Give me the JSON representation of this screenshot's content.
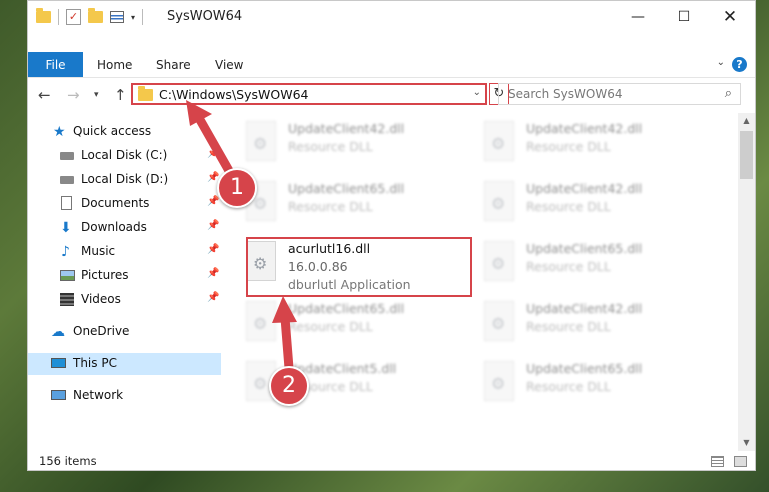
{
  "window": {
    "title": "SysWOW64"
  },
  "ribbon": {
    "tabs": [
      "File",
      "Home",
      "Share",
      "View"
    ]
  },
  "address": {
    "path": "C:\\Windows\\SysWOW64"
  },
  "search": {
    "placeholder": "Search SysWOW64"
  },
  "sidebar": {
    "items": [
      {
        "label": "Quick access"
      },
      {
        "label": "Local Disk (C:)"
      },
      {
        "label": "Local Disk (D:)"
      },
      {
        "label": "Documents"
      },
      {
        "label": "Downloads"
      },
      {
        "label": "Music"
      },
      {
        "label": "Pictures"
      },
      {
        "label": "Videos"
      },
      {
        "label": "OneDrive"
      },
      {
        "label": "This PC"
      },
      {
        "label": "Network"
      }
    ]
  },
  "files": {
    "left": [
      {
        "name": "UpdateClient42.dll",
        "type": "Resource DLL"
      },
      {
        "name": "UpdateClient65.dll",
        "type": "Resource DLL"
      },
      {
        "name": "acurlutl16.dll",
        "version": "16.0.0.86",
        "type": "dburlutl Application"
      },
      {
        "name": "UpdateClient65.dll",
        "type": "Resource DLL"
      },
      {
        "name": "UpdateClient5.dll",
        "type": "Resource DLL"
      }
    ],
    "right": [
      {
        "name": "UpdateClient42.dll",
        "type": "Resource DLL"
      },
      {
        "name": "UpdateClient42.dll",
        "type": "Resource DLL"
      },
      {
        "name": "UpdateClient65.dll",
        "type": "Resource DLL"
      },
      {
        "name": "UpdateClient42.dll",
        "type": "Resource DLL"
      },
      {
        "name": "UpdateClient65.dll",
        "type": "Resource DLL"
      }
    ]
  },
  "status": {
    "items": "156 items"
  },
  "callouts": {
    "one": "1",
    "two": "2"
  },
  "colors": {
    "accent": "#1979ca",
    "highlight": "#d6444a",
    "selected": "#cce8ff"
  }
}
